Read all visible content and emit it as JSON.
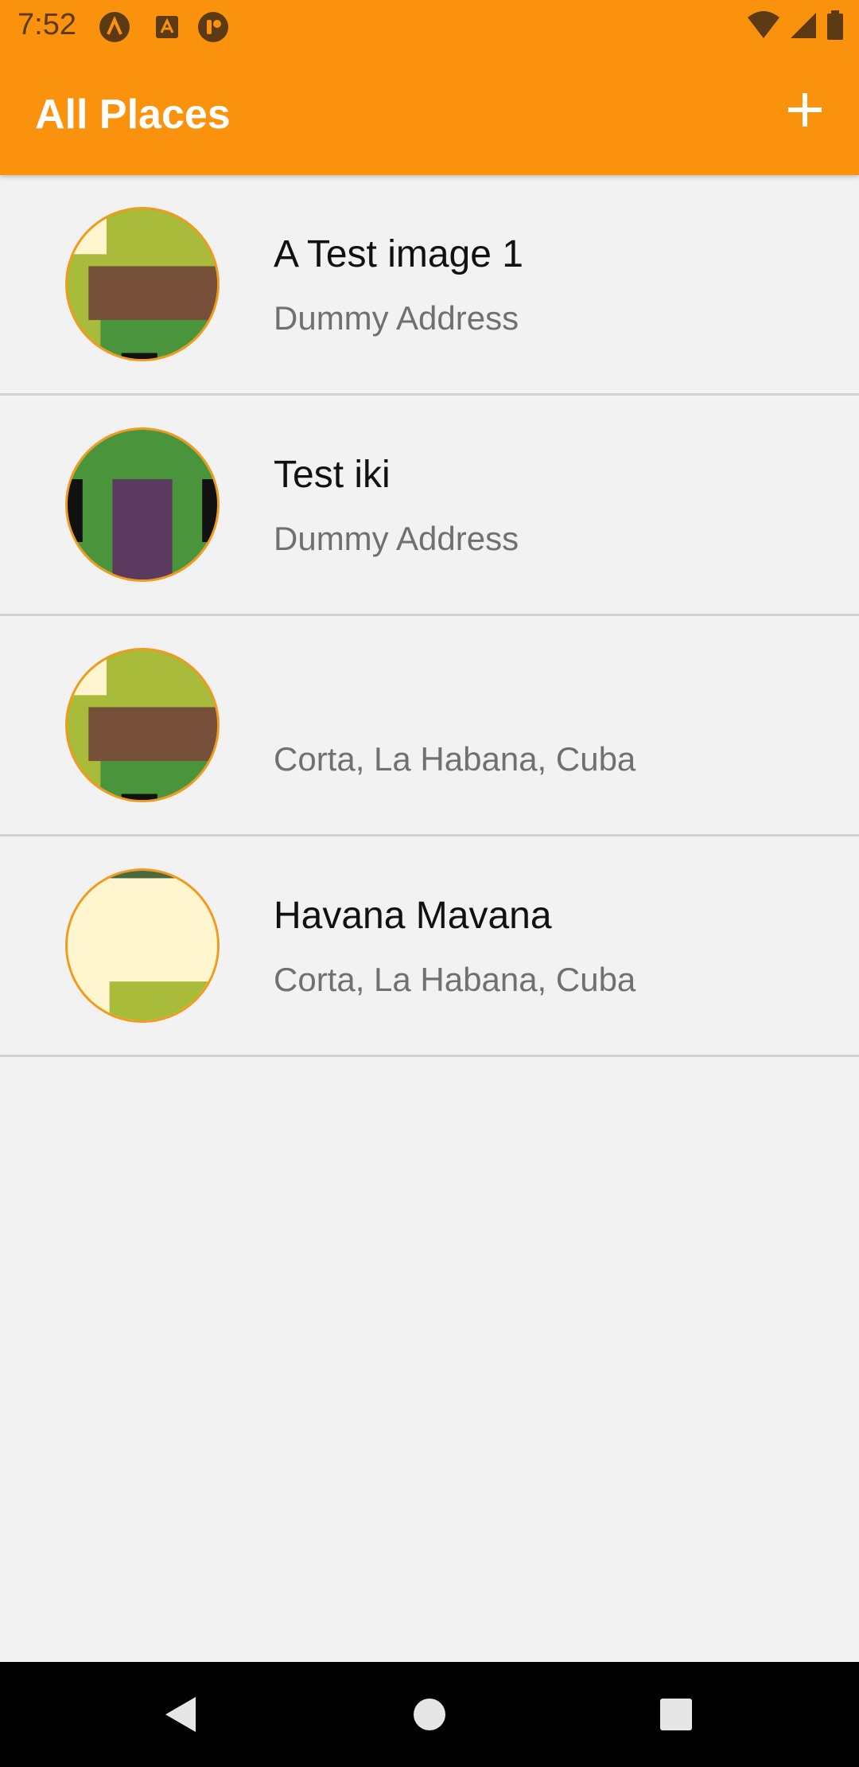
{
  "status_bar": {
    "time": "7:52",
    "icons": [
      "app-notification-icon-a",
      "app-notification-icon-b",
      "app-notification-icon-c",
      "wifi-icon",
      "signal-icon",
      "battery-icon"
    ]
  },
  "app_bar": {
    "title": "All Places",
    "add_icon": "plus-icon"
  },
  "places": [
    {
      "title": "A Test image 1",
      "address": "Dummy Address",
      "thumb": "green-brown"
    },
    {
      "title": "Test iki",
      "address": "Dummy Address",
      "thumb": "green-purple"
    },
    {
      "title": "",
      "address": "Corta, La Habana, Cuba",
      "thumb": "green-brown"
    },
    {
      "title": "Havana Mavana",
      "address": "Corta, La Habana, Cuba",
      "thumb": "cream"
    }
  ],
  "nav_bar": {
    "icons": [
      "back-icon",
      "home-icon",
      "recents-icon"
    ]
  },
  "colors": {
    "accent": "#fb920d",
    "thumb_border": "#f29a1c",
    "background": "#f2f2f2",
    "divider": "#d2d2d2"
  }
}
